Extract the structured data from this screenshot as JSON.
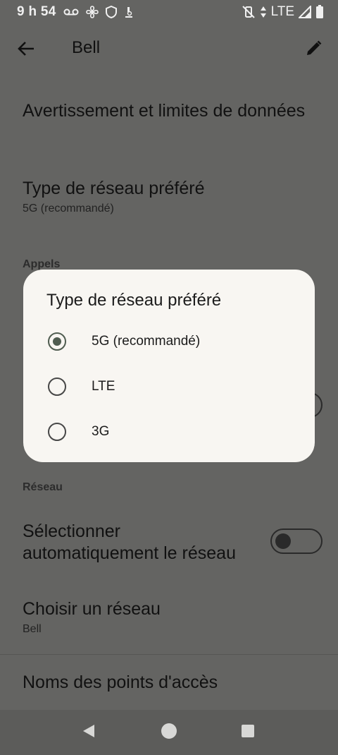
{
  "status_bar": {
    "time": "9 h 54",
    "network": "LTE"
  },
  "app_bar": {
    "title": "Bell"
  },
  "settings": {
    "data_warning": "Avertissement et limites de données",
    "preferred_network": {
      "title": "Type de réseau préféré",
      "value": "5G (recommandé)"
    },
    "calls_header": "Appels",
    "network_header": "Réseau",
    "auto_select": {
      "title": "Sélectionner automatiquement le réseau",
      "enabled": false
    },
    "choose_network": {
      "title": "Choisir un réseau",
      "value": "Bell"
    },
    "apn": "Noms des points d'accès"
  },
  "dialog": {
    "title": "Type de réseau préféré",
    "options": [
      {
        "label": "5G (recommandé)",
        "selected": true
      },
      {
        "label": "LTE",
        "selected": false
      },
      {
        "label": "3G",
        "selected": false
      }
    ]
  },
  "colors": {
    "scrim_background": "#646462",
    "dialog_background": "#f8f6f2",
    "radio_accent": "#4f5c50"
  },
  "icons": {
    "back": "arrow-back-icon",
    "edit": "pencil-icon",
    "nav_back": "triangle-back-icon",
    "nav_home": "circle-home-icon",
    "nav_recents": "square-recents-icon"
  }
}
